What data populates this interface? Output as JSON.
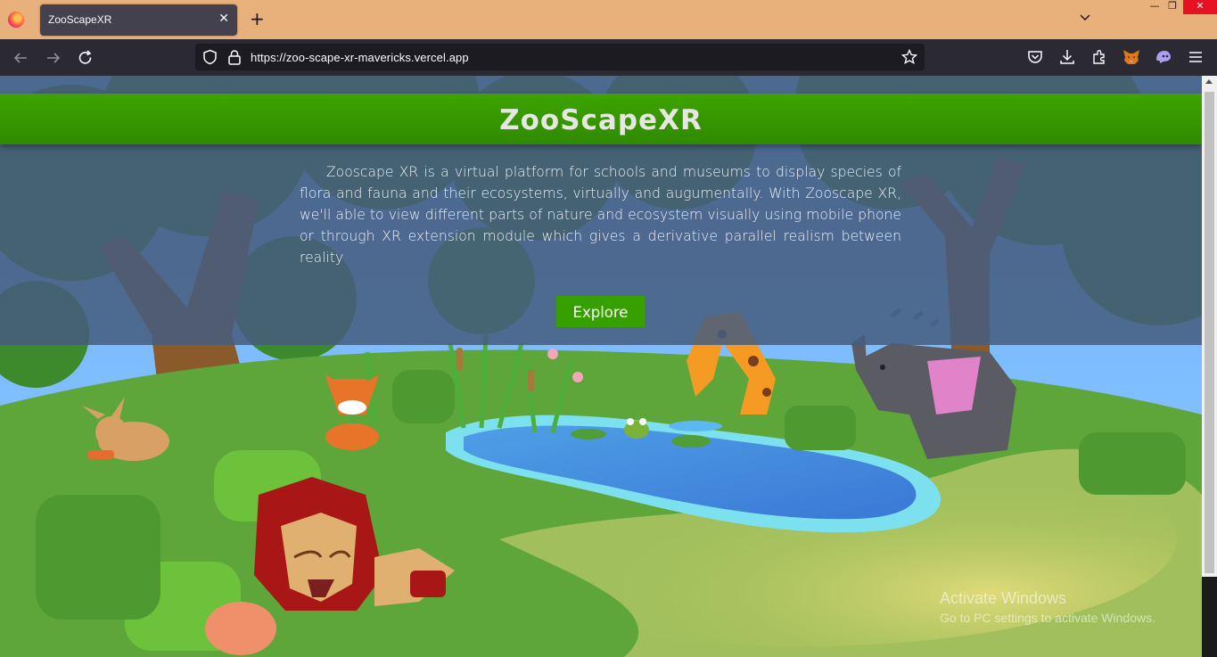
{
  "browser": {
    "tab": {
      "title": "ZooScapeXR",
      "close": "✕"
    },
    "new_tab": "+",
    "window_controls": {
      "minimize": "—",
      "maximize": "❐",
      "close": "✕"
    },
    "url": "https://zoo-scape-xr-mavericks.vercel.app",
    "icons": [
      "firefox-logo-icon",
      "back-icon",
      "forward-icon",
      "reload-icon",
      "shield-icon",
      "lock-icon",
      "star-icon",
      "pocket-icon",
      "download-icon",
      "extensions-icon",
      "metamask-icon",
      "ghost-extension-icon",
      "menu-icon"
    ]
  },
  "site": {
    "title": "ZooScapeXR",
    "description": "Zooscape XR is a virtual platform for schools and museums to display species of flora and fauna and their ecosystems, virtually and augumentally. With Zooscape XR, we'll able to view different parts of nature and ecosystem visually using mobile phone or through XR extension module which gives a derivative parallel realism between reality",
    "explore_label": "Explore",
    "colors": {
      "header_green": "#3ea400",
      "button_green": "#36a000",
      "overlay": "#465c7e"
    }
  },
  "watermark": {
    "line1": "Activate Windows",
    "line2": "Go to PC settings to activate Windows."
  }
}
